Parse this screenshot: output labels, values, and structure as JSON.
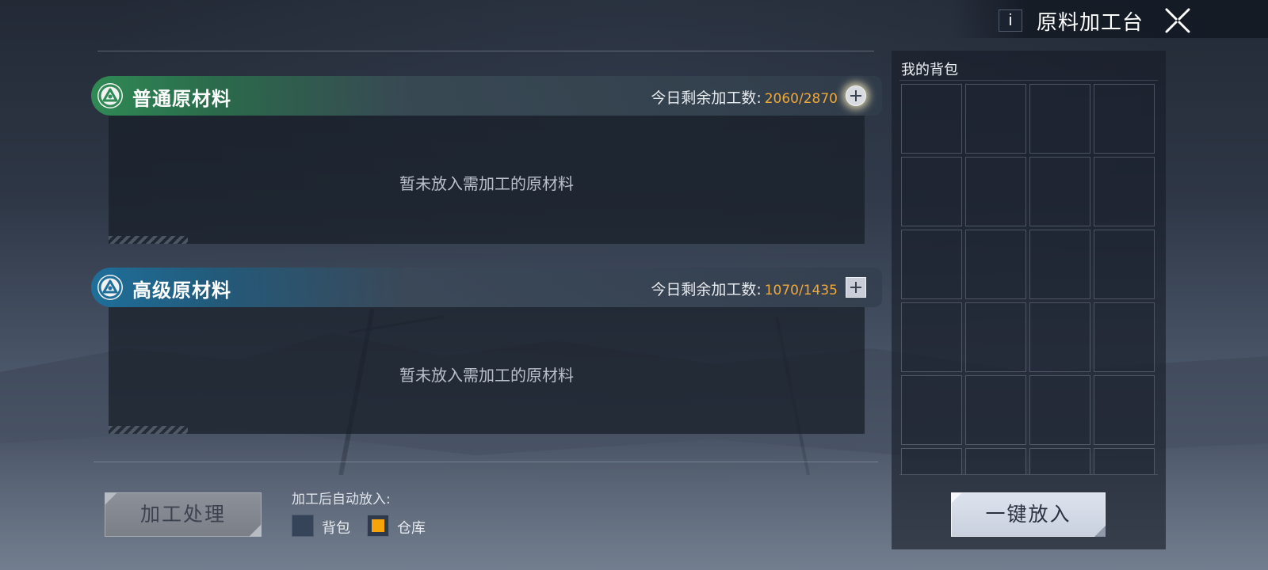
{
  "header": {
    "info_label": "i",
    "title": "原料加工台",
    "close_icon": "close-x-icon"
  },
  "sections": {
    "normal": {
      "title": "普通原材料",
      "quota_label": "今日剩余加工数:",
      "quota_value": "2060/2870",
      "empty_text": "暂未放入需加工的原材料",
      "accent": "#2f8a55"
    },
    "advanced": {
      "title": "高级原材料",
      "quota_label": "今日剩余加工数:",
      "quota_value": "1070/1435",
      "empty_text": "暂未放入需加工的原材料",
      "accent": "#1e6f9a"
    }
  },
  "footer": {
    "process_button": "加工处理",
    "auto_place_label": "加工后自动放入:",
    "options": [
      {
        "label": "背包",
        "checked": false
      },
      {
        "label": "仓库",
        "checked": true
      }
    ],
    "check_color": "#f5a40a"
  },
  "bag": {
    "title": "我的背包",
    "slots": 24,
    "put_all_button": "一键放入"
  }
}
